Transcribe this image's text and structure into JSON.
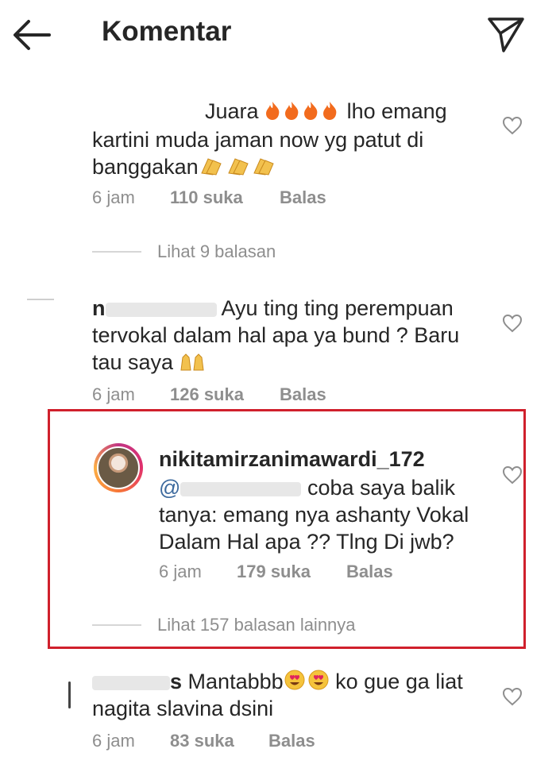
{
  "header": {
    "title": "Komentar",
    "back_icon": "arrow-left-icon",
    "send_icon": "paper-plane-icon"
  },
  "comments": [
    {
      "line1_pre": "Juara",
      "line1_post": "lho emang",
      "line2": "kartini muda jaman now yg patut di",
      "line3": "banggakan",
      "time": "6 jam",
      "likes": "110 suka",
      "reply": "Balas",
      "view_replies": "Lihat 9 balasan",
      "emojis": [
        "fire-emoji",
        "clap-emoji"
      ]
    },
    {
      "username_visible": "n",
      "line1": "Ayu ting ting perempuan",
      "line2": "tervokal dalam hal apa ya bund ? Baru",
      "line3": "tau saya",
      "time": "6 jam",
      "likes": "126 suka",
      "reply": "Balas",
      "emojis": [
        "raised-hands-emoji"
      ]
    },
    {
      "username": "nikitamirzanimawardi_172",
      "mention": "@",
      "line1": "coba saya balik",
      "line2": "tanya: emang nya ashanty Vokal",
      "line3": "Dalam Hal apa ?? Tlng Di jwb?",
      "time": "6 jam",
      "likes": "179 suka",
      "reply": "Balas",
      "view_replies": "Lihat 157 balasan lainnya"
    },
    {
      "username_visible": "s",
      "line1_pre": "Mantabbb",
      "line1_post": "ko gue ga liat",
      "line2": "nagita slavina dsini",
      "time": "6 jam",
      "likes": "83 suka",
      "reply": "Balas",
      "emojis": [
        "heart-eyes-emoji"
      ]
    }
  ],
  "colors": {
    "text": "#262626",
    "meta": "#8e8e8e",
    "highlight_border": "#d0202c",
    "fire": "#f26b1d",
    "clap": "#f2c14e"
  }
}
